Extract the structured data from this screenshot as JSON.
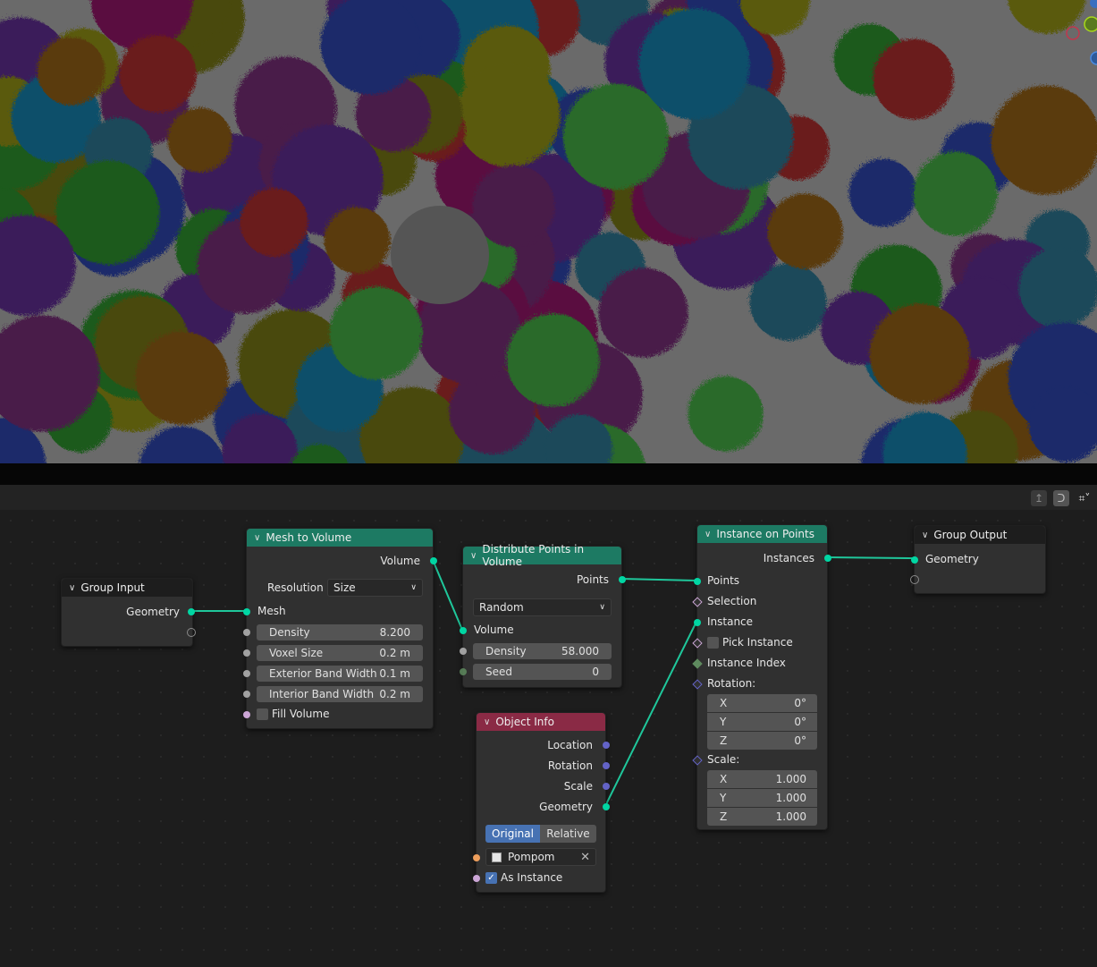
{
  "viewport": {
    "description": "3D viewport render of colorful pompom instances",
    "gizmo_axes": [
      "x-axis-circle",
      "y-axis-circle",
      "z-axis-circle"
    ]
  },
  "node_editor_header": {
    "icons": [
      "parent-node-tree-icon",
      "snap-icon",
      "overlay-icon"
    ]
  },
  "nodes": {
    "group_input": {
      "title": "Group Input",
      "outputs": [
        "Geometry"
      ]
    },
    "mesh_to_volume": {
      "title": "Mesh to Volume",
      "output": "Volume",
      "resolution_label": "Resolution",
      "resolution_value": "Size",
      "mesh_input": "Mesh",
      "fields": [
        {
          "label": "Density",
          "value": "8.200"
        },
        {
          "label": "Voxel Size",
          "value": "0.2 m"
        },
        {
          "label": "Exterior Band Width",
          "value": "0.1 m"
        },
        {
          "label": "Interior Band Width",
          "value": "0.2 m"
        }
      ],
      "fill_volume_label": "Fill Volume",
      "fill_volume_checked": false
    },
    "distribute_points": {
      "title": "Distribute Points in Volume",
      "output": "Points",
      "mode": "Random",
      "volume_input": "Volume",
      "fields": [
        {
          "label": "Density",
          "value": "58.000"
        },
        {
          "label": "Seed",
          "value": "0"
        }
      ]
    },
    "instance_on_points": {
      "title": "Instance on Points",
      "output": "Instances",
      "inputs": [
        "Points",
        "Selection",
        "Instance"
      ],
      "pick_instance_label": "Pick Instance",
      "pick_instance_checked": false,
      "instance_index_label": "Instance Index",
      "rotation_label": "Rotation:",
      "rotation": [
        {
          "axis": "X",
          "value": "0°"
        },
        {
          "axis": "Y",
          "value": "0°"
        },
        {
          "axis": "Z",
          "value": "0°"
        }
      ],
      "scale_label": "Scale:",
      "scale": [
        {
          "axis": "X",
          "value": "1.000"
        },
        {
          "axis": "Y",
          "value": "1.000"
        },
        {
          "axis": "Z",
          "value": "1.000"
        }
      ]
    },
    "object_info": {
      "title": "Object Info",
      "outputs": [
        "Location",
        "Rotation",
        "Scale",
        "Geometry"
      ],
      "transform_modes": [
        "Original",
        "Relative"
      ],
      "transform_selected": "Original",
      "object_name": "Pompom",
      "as_instance_label": "As Instance",
      "as_instance_checked": true
    },
    "group_output": {
      "title": "Group Output",
      "inputs": [
        "Geometry"
      ]
    }
  },
  "colors": {
    "geometry_header": "#1d7a63",
    "object_info_header": "#8a2a45",
    "geometry_socket": "#00d6a3",
    "link": "#1fc79b",
    "selected_toggle": "#4772b3"
  }
}
